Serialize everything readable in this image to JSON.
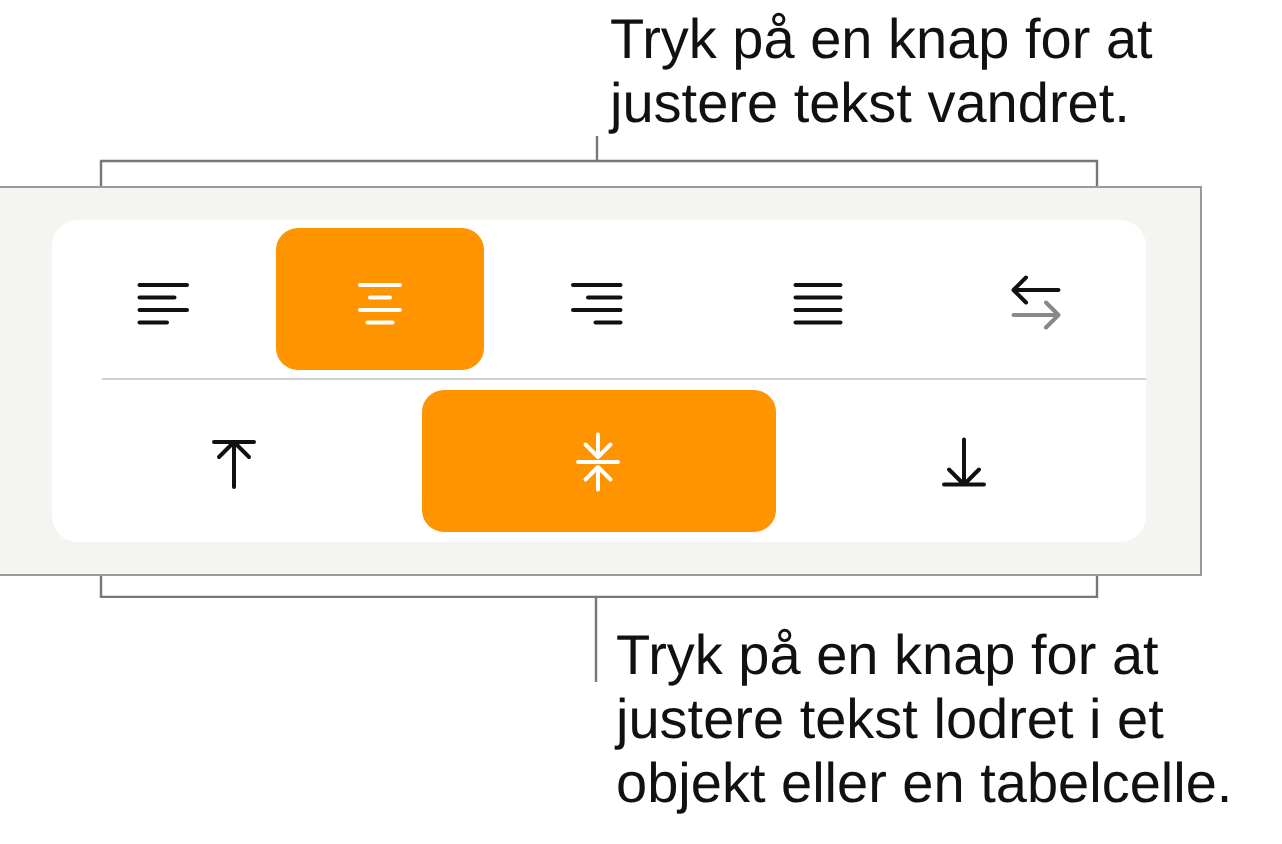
{
  "top_callout": {
    "text": "Tryk på en knap for at justere tekst vandret."
  },
  "horizontal_alignment": [
    {
      "kind": "left",
      "selected": false
    },
    {
      "kind": "center",
      "selected": true
    },
    {
      "kind": "right",
      "selected": false
    },
    {
      "kind": "justify",
      "selected": false
    },
    {
      "kind": "direction",
      "selected": false
    }
  ],
  "vertical_alignment": [
    {
      "kind": "top",
      "selected": false
    },
    {
      "kind": "middle",
      "selected": true
    },
    {
      "kind": "bottom",
      "selected": false
    }
  ],
  "bottom_callout": {
    "text": "Tryk på en knap for at justere tekst lodret i et objekt eller en tabelcelle."
  }
}
